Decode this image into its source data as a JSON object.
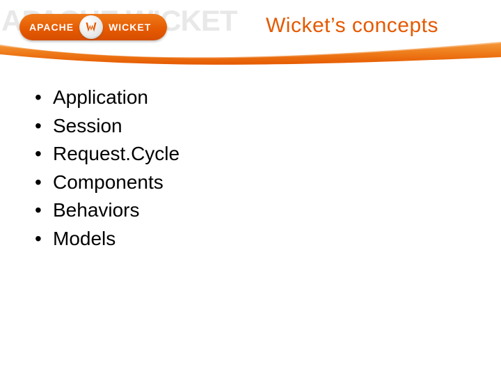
{
  "header": {
    "title": "Wicket’s concepts",
    "watermark": "APACHE WICKET",
    "logo": {
      "apache": "APACHE",
      "wicket": "WICKET"
    }
  },
  "bullets": [
    "Application",
    "Session",
    "Request.Cycle",
    "Components",
    "Behaviors",
    "Models"
  ],
  "colors": {
    "accent": "#e55900",
    "accent_light": "#f08428"
  }
}
